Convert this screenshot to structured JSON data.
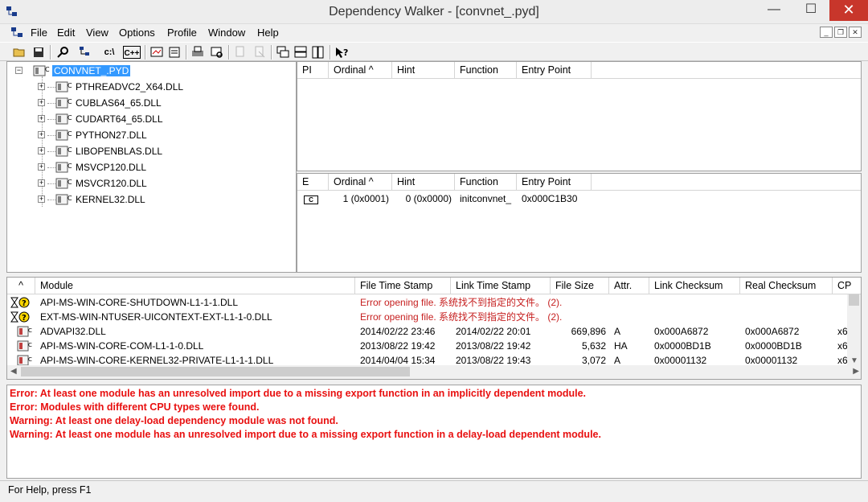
{
  "window": {
    "title": "Dependency Walker - [convnet_.pyd]",
    "min_glyph": "—",
    "max_glyph": "☐",
    "close_glyph": "✕"
  },
  "menu": {
    "items": [
      "File",
      "Edit",
      "View",
      "Options",
      "Profile",
      "Window",
      "Help"
    ]
  },
  "toolbar": {
    "buttons": [
      "open-icon",
      "save-icon",
      "find-icon",
      "auto-expand-icon",
      "full-paths-icon",
      "undecorate-cpp-icon",
      "view-module-icon",
      "properties-icon",
      "print-icon",
      "external-viewer-icon",
      "copy-icon",
      "clear-log-icon",
      "cascade-icon",
      "tile-horizontal-icon",
      "tile-vertical-icon",
      "help-icon"
    ],
    "labels": {
      "full_paths": "c:\\",
      "undecorate": "C++"
    }
  },
  "tree": {
    "root": "CONVNET_.PYD",
    "children": [
      "PTHREADVC2_X64.DLL",
      "CUBLAS64_65.DLL",
      "CUDART64_65.DLL",
      "PYTHON27.DLL",
      "LIBOPENBLAS.DLL",
      "MSVCP120.DLL",
      "MSVCR120.DLL",
      "KERNEL32.DLL"
    ]
  },
  "imports": {
    "columns": [
      "PI",
      "Ordinal ^",
      "Hint",
      "Function",
      "Entry Point"
    ]
  },
  "exports": {
    "columns": [
      "E",
      "Ordinal ^",
      "Hint",
      "Function",
      "Entry Point"
    ],
    "rows": [
      {
        "icon": "C",
        "ordinal": "1 (0x0001)",
        "hint": "0 (0x0000)",
        "function": "initconvnet_",
        "entry": "0x000C1B30"
      }
    ]
  },
  "modules": {
    "columns": [
      "^",
      "Module",
      "File Time Stamp",
      "Link Time Stamp",
      "File Size",
      "Attr.",
      "Link Checksum",
      "Real Checksum",
      "CP"
    ],
    "rows": [
      {
        "icon": "missing",
        "module": "API-MS-WIN-CORE-SHUTDOWN-L1-1-1.DLL",
        "error": "Error opening file. 系统找不到指定的文件。 (2)."
      },
      {
        "icon": "missing",
        "module": "EXT-MS-WIN-NTUSER-UICONTEXT-EXT-L1-1-0.DLL",
        "error": "Error opening file. 系统找不到指定的文件。 (2)."
      },
      {
        "icon": "module",
        "module": "ADVAPI32.DLL",
        "file_ts": "2014/02/22 23:46",
        "link_ts": "2014/02/22 20:01",
        "size": "669,896",
        "attr": "A",
        "link_ck": "0x000A6872",
        "real_ck": "0x000A6872",
        "cpu": "x6"
      },
      {
        "icon": "module",
        "module": "API-MS-WIN-CORE-COM-L1-1-0.DLL",
        "file_ts": "2013/08/22 19:42",
        "link_ts": "2013/08/22 19:42",
        "size": "5,632",
        "attr": "HA",
        "link_ck": "0x0000BD1B",
        "real_ck": "0x0000BD1B",
        "cpu": "x6"
      },
      {
        "icon": "module",
        "module": "API-MS-WIN-CORE-KERNEL32-PRIVATE-L1-1-1.DLL",
        "file_ts": "2014/04/04 15:34",
        "link_ts": "2013/08/22 19:43",
        "size": "3,072",
        "attr": "A",
        "link_ck": "0x00001132",
        "real_ck": "0x00001132",
        "cpu": "x6"
      }
    ]
  },
  "log": {
    "lines": [
      "Error: At least one module has an unresolved import due to a missing export function in an implicitly dependent module.",
      "Error: Modules with different CPU types were found.",
      "Warning: At least one delay-load dependency module was not found.",
      "Warning: At least one module has an unresolved import due to a missing export function in a delay-load dependent module."
    ]
  },
  "status": {
    "text": "For Help, press F1"
  }
}
